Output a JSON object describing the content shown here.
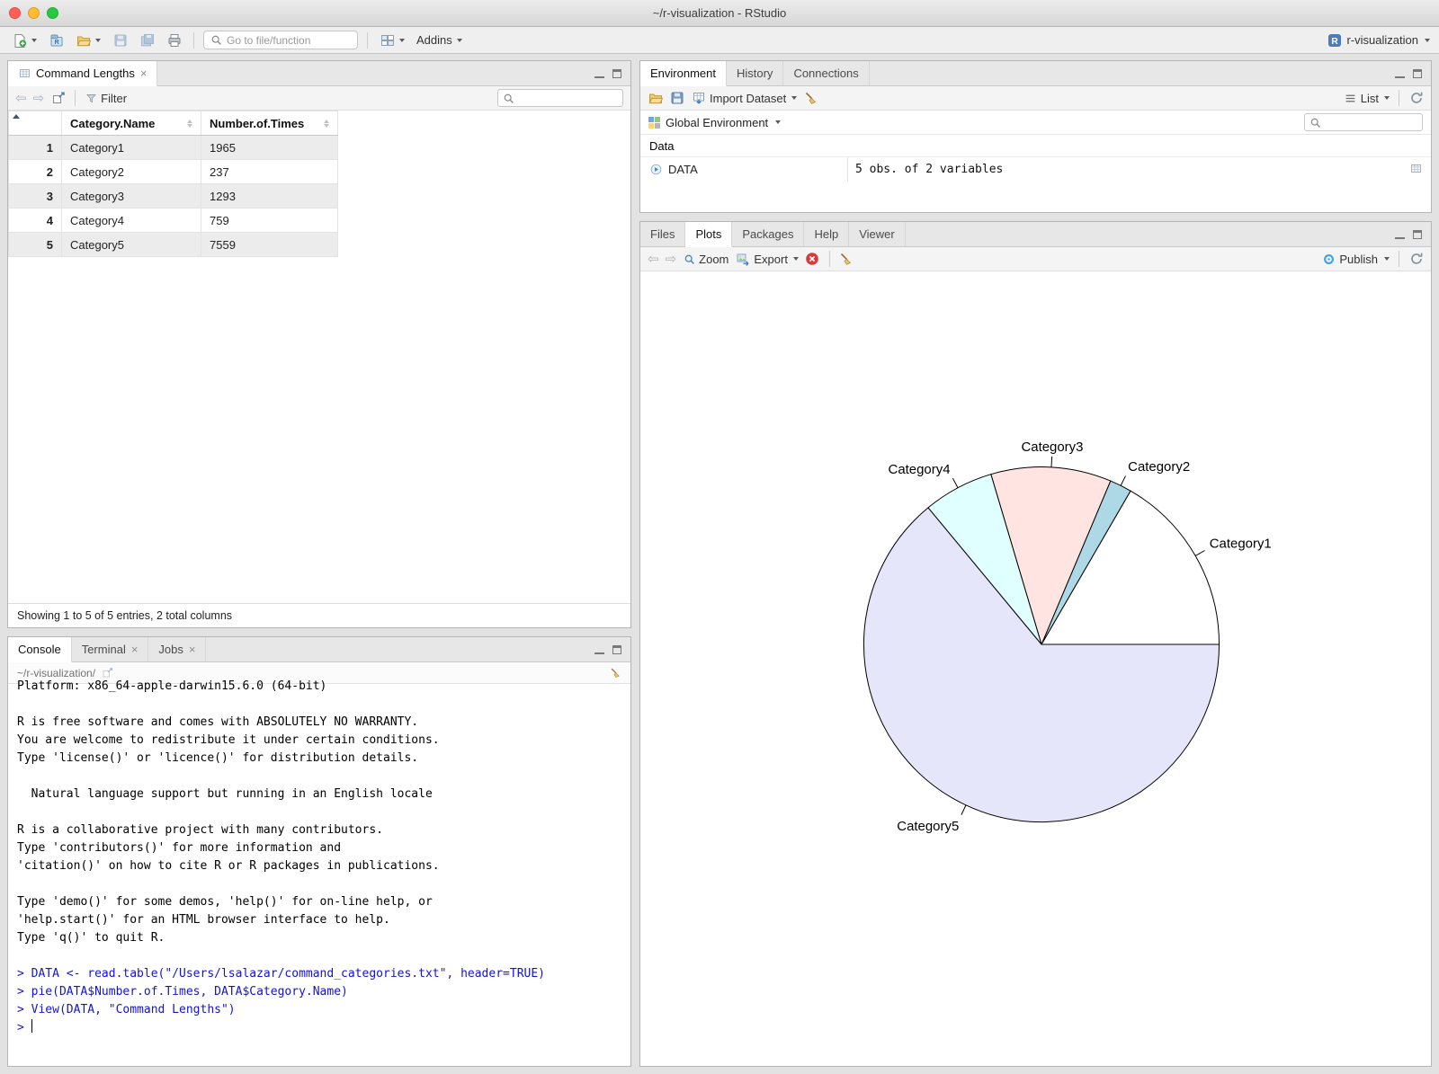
{
  "window": {
    "title": "~/r-visualization - RStudio"
  },
  "main_toolbar": {
    "goto_placeholder": "Go to file/function",
    "addins_label": "Addins",
    "project_label": "r-visualization"
  },
  "data_viewer": {
    "tab_title": "Command Lengths",
    "filter_label": "Filter",
    "columns": [
      "Category.Name",
      "Number.of.Times"
    ],
    "rows": [
      {
        "n": "1",
        "category": "Category1",
        "times": "1965"
      },
      {
        "n": "2",
        "category": "Category2",
        "times": "237"
      },
      {
        "n": "3",
        "category": "Category3",
        "times": "1293"
      },
      {
        "n": "4",
        "category": "Category4",
        "times": "759"
      },
      {
        "n": "5",
        "category": "Category5",
        "times": "7559"
      }
    ],
    "status": "Showing 1 to 5 of 5 entries, 2 total columns"
  },
  "console": {
    "tabs": [
      "Console",
      "Terminal",
      "Jobs"
    ],
    "path": "~/r-visualization/",
    "lines": [
      {
        "text": "Platform: x86_64-apple-darwin15.6.0 (64-bit)",
        "type": "output"
      },
      {
        "text": "",
        "type": "output"
      },
      {
        "text": "R is free software and comes with ABSOLUTELY NO WARRANTY.",
        "type": "output"
      },
      {
        "text": "You are welcome to redistribute it under certain conditions.",
        "type": "output"
      },
      {
        "text": "Type 'license()' or 'licence()' for distribution details.",
        "type": "output"
      },
      {
        "text": "",
        "type": "output"
      },
      {
        "text": "  Natural language support but running in an English locale",
        "type": "output"
      },
      {
        "text": "",
        "type": "output"
      },
      {
        "text": "R is a collaborative project with many contributors.",
        "type": "output"
      },
      {
        "text": "Type 'contributors()' for more information and",
        "type": "output"
      },
      {
        "text": "'citation()' on how to cite R or R packages in publications.",
        "type": "output"
      },
      {
        "text": "",
        "type": "output"
      },
      {
        "text": "Type 'demo()' for some demos, 'help()' for on-line help, or",
        "type": "output"
      },
      {
        "text": "'help.start()' for an HTML browser interface to help.",
        "type": "output"
      },
      {
        "text": "Type 'q()' to quit R.",
        "type": "output"
      },
      {
        "text": "",
        "type": "output"
      },
      {
        "text": "> DATA <- read.table(\"/Users/lsalazar/command_categories.txt\", header=TRUE)",
        "type": "input"
      },
      {
        "text": "> pie(DATA$Number.of.Times, DATA$Category.Name)",
        "type": "input"
      },
      {
        "text": "> View(DATA, \"Command Lengths\")",
        "type": "input"
      }
    ],
    "prompt": ">"
  },
  "environment": {
    "tabs": [
      "Environment",
      "History",
      "Connections"
    ],
    "import_dataset_label": "Import Dataset",
    "list_label": "List",
    "scope_label": "Global Environment",
    "section_label": "Data",
    "objects": [
      {
        "name": "DATA",
        "summary": "5 obs. of 2 variables"
      }
    ]
  },
  "plots_pane": {
    "tabs": [
      "Files",
      "Plots",
      "Packages",
      "Help",
      "Viewer"
    ],
    "zoom_label": "Zoom",
    "export_label": "Export",
    "publish_label": "Publish"
  },
  "colors": {
    "console_input": "#1414cc"
  },
  "chart_data": {
    "type": "pie",
    "title": "",
    "categories": [
      "Category1",
      "Category2",
      "Category3",
      "Category4",
      "Category5"
    ],
    "values": [
      1965,
      237,
      1293,
      759,
      7559
    ],
    "colors": [
      "#ffffff",
      "#add8e6",
      "#ffe4e1",
      "#e0ffff",
      "#e6e6fa"
    ],
    "start_angle_deg": 0,
    "direction": "counterclockwise",
    "legend": "none",
    "labels_from": "categories"
  }
}
